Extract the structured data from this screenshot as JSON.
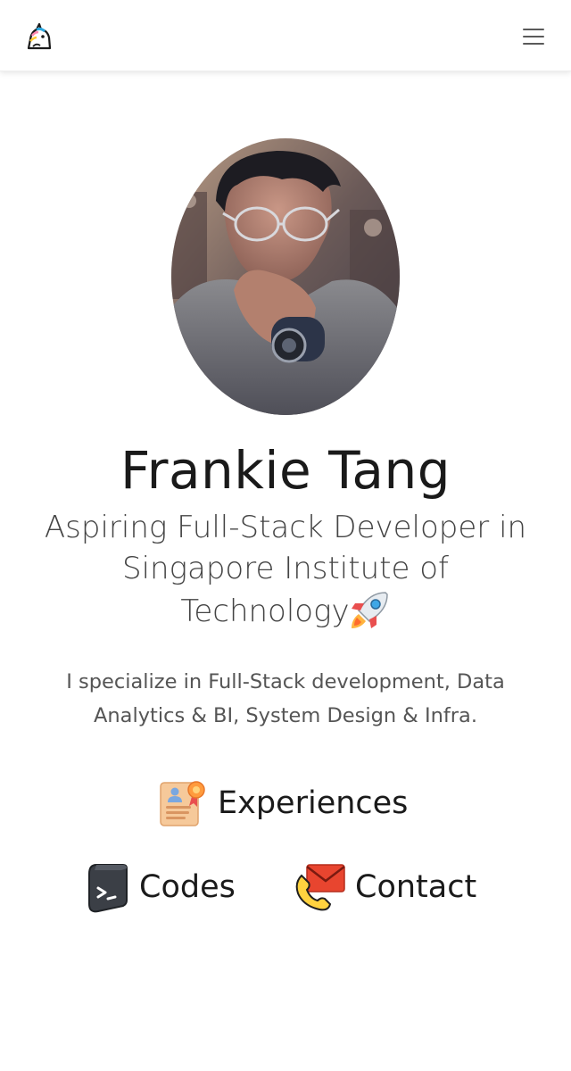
{
  "navbar": {
    "logo_icon": "unicorn-icon",
    "menu_icon": "hamburger-menu-icon"
  },
  "profile": {
    "avatar": "profile-photo",
    "name": "Frankie Tang",
    "tagline": "Aspiring Full-Stack Developer in Singapore Institute of Technology",
    "tagline_emoji": "rocket-icon",
    "summary": "I specialize in Full-Stack development, Data Analytics & BI, System Design & Infra."
  },
  "links": {
    "experiences": {
      "label": "Experiences",
      "icon": "resume-certificate-icon"
    },
    "codes": {
      "label": "Codes",
      "icon": "terminal-icon"
    },
    "contact": {
      "label": "Contact",
      "icon": "phone-envelope-icon"
    }
  },
  "colors": {
    "text_dark": "#1a1a1a",
    "text_muted": "#555555",
    "navbar_bg": "#ffffff"
  }
}
